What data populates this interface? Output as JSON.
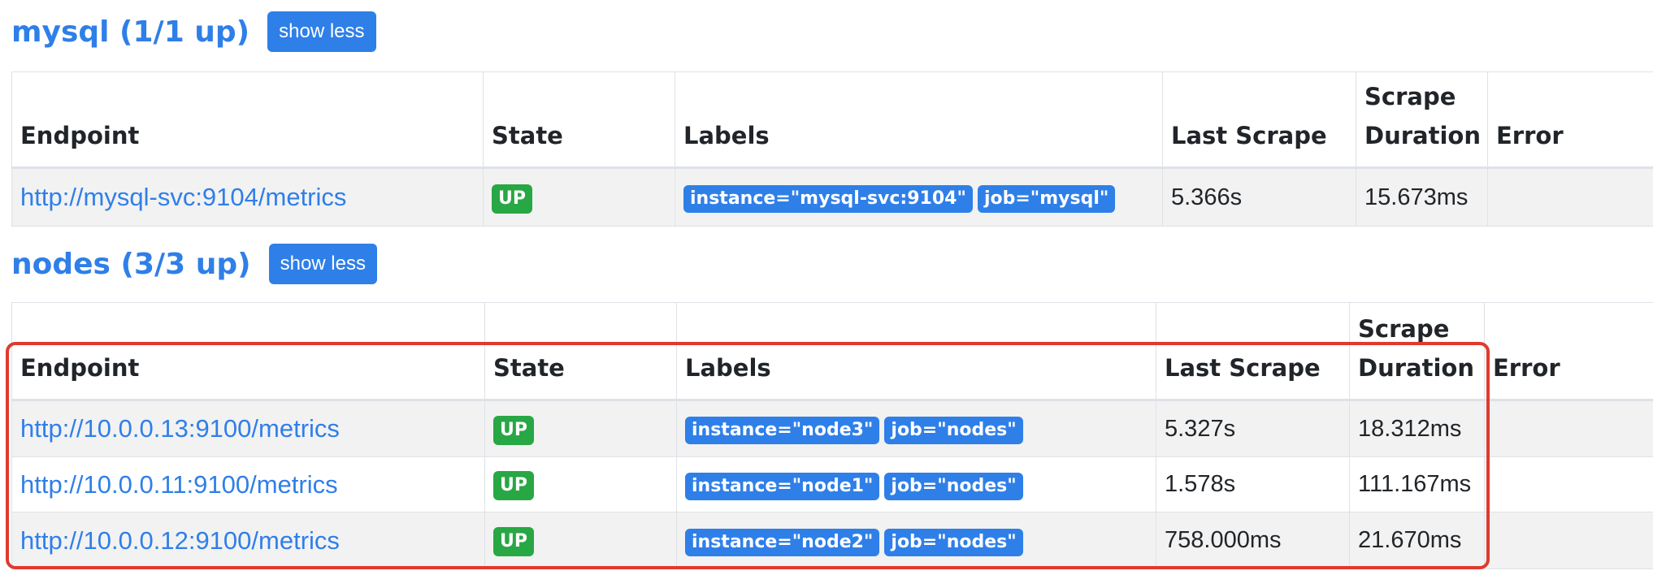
{
  "sections": {
    "mysql": {
      "title": "mysql (1/1 up)",
      "button_label": "show less",
      "headers": {
        "endpoint": "Endpoint",
        "state": "State",
        "labels": "Labels",
        "last_scrape": "Last Scrape",
        "scrape_duration": "Scrape Duration",
        "error": "Error"
      },
      "rows": [
        {
          "endpoint": "http://mysql-svc:9104/metrics",
          "state": "UP",
          "labels": [
            "instance=\"mysql-svc:9104\"",
            "job=\"mysql\""
          ],
          "last_scrape": "5.366s",
          "scrape_duration": "15.673ms",
          "error": ""
        }
      ]
    },
    "nodes": {
      "title": "nodes (3/3 up)",
      "button_label": "show less",
      "headers": {
        "endpoint": "Endpoint",
        "state": "State",
        "labels": "Labels",
        "last_scrape": "Last Scrape",
        "scrape_duration": "Scrape Duration",
        "error": "Error"
      },
      "rows": [
        {
          "endpoint": "http://10.0.0.13:9100/metrics",
          "state": "UP",
          "labels": [
            "instance=\"node3\"",
            "job=\"nodes\""
          ],
          "last_scrape": "5.327s",
          "scrape_duration": "18.312ms",
          "error": ""
        },
        {
          "endpoint": "http://10.0.0.11:9100/metrics",
          "state": "UP",
          "labels": [
            "instance=\"node1\"",
            "job=\"nodes\""
          ],
          "last_scrape": "1.578s",
          "scrape_duration": "111.167ms",
          "error": ""
        },
        {
          "endpoint": "http://10.0.0.12:9100/metrics",
          "state": "UP",
          "labels": [
            "instance=\"node2\"",
            "job=\"nodes\""
          ],
          "last_scrape": "758.000ms",
          "scrape_duration": "21.670ms",
          "error": ""
        }
      ]
    }
  },
  "colors": {
    "accent": "#2f7fe8",
    "state_up": "#28a745",
    "highlight": "#e03a2f"
  }
}
